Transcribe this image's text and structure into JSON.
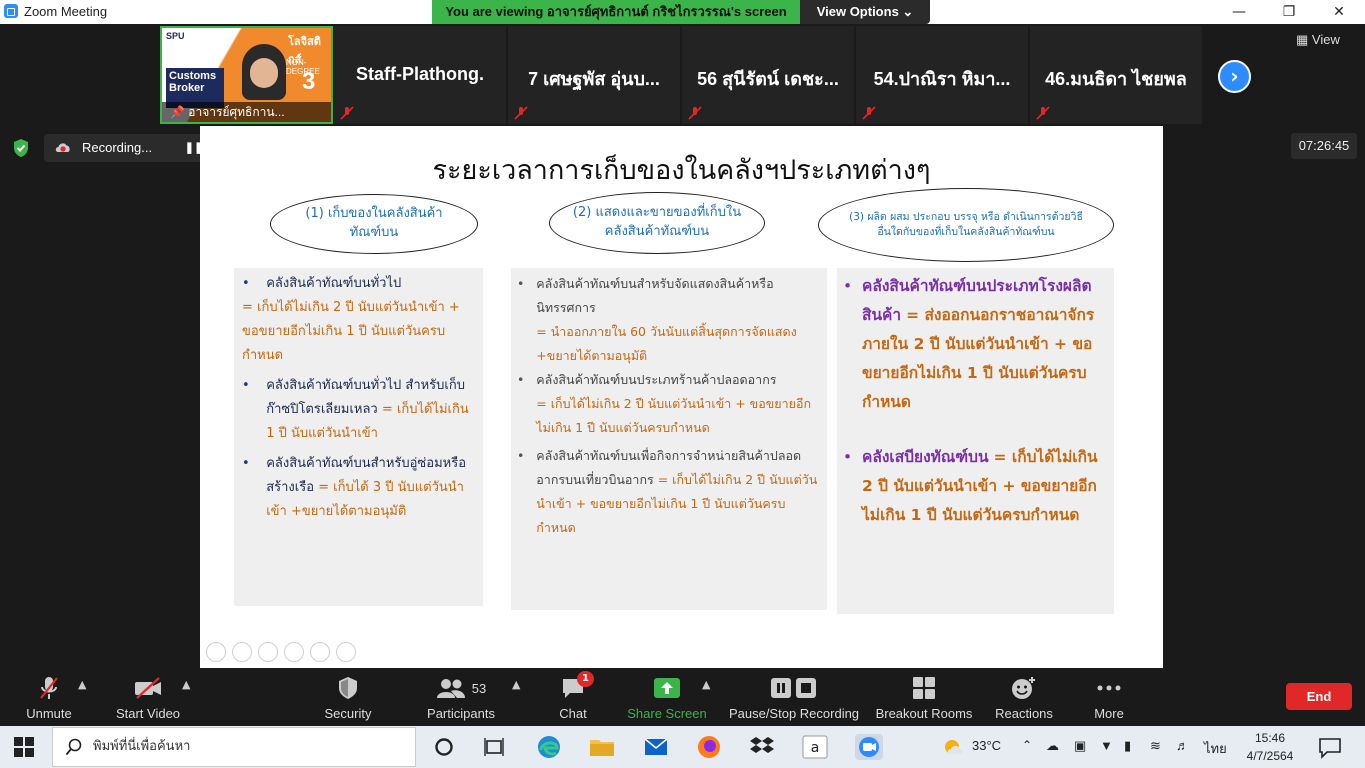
{
  "window": {
    "title": "Zoom Meeting"
  },
  "banner": {
    "viewing": "You are viewing อาจารย์ศุทธิกานต์ กริชไกรวรรณ's screen",
    "view_options": "View Options ⌄"
  },
  "participants_strip": {
    "active": {
      "name": "อาจารย์ศุทธิกาน...",
      "poster_text": "Customs Broker",
      "poster_brand": "SPU",
      "poster_headline": "โลจิสติกส์",
      "poster_sub": "NON-DEGREE",
      "poster_number": "3"
    },
    "tiles": [
      "Staff-Plathong.",
      "7 เศษฐพัส อุ่นบ...",
      "56 สุนีรัตน์ เดชะ...",
      "54.ปาณิรา หิมา...",
      "46.มนธิดา ไชยพล"
    ],
    "view_label": "View",
    "next_label": "›"
  },
  "recording": {
    "label": "Recording...",
    "pause": "❚❚"
  },
  "timer": "07:26:45",
  "slide": {
    "title": "ระยะเวลาการเก็บของในคลังฯประเภทต่างๆ",
    "headers": [
      "(1) เก็บของในคลังสินค้าทัณฑ์บน",
      "(2) แสดงและขายของที่เก็บในคลังสินค้าทัณฑ์บน",
      "(3) ผลิต ผสม ประกอบ บรรจุ หรือ ดำเนินการด้วยวิธีอื่นใดกับของที่เก็บในคลังสินค้าทัณฑ์บน"
    ],
    "col1": [
      {
        "dark": "คลังสินค้าทัณฑ์บนทั่วไป",
        "orange": "= เก็บได้ไม่เกิน 2 ปี นับแต่วันนำเข้า + ขอขยายอีกไม่เกิน 1 ปี นับแต่วันครบกำหนด"
      },
      {
        "dark": "คลังสินค้าทัณฑ์บนทั่วไป สำหรับเก็บก๊าซปิโตรเลียมเหลว",
        "orange": "= เก็บได้ไม่เกิน 1 ปี นับแต่วันนำเข้า"
      },
      {
        "dark": "คลังสินค้าทัณฑ์บนสำหรับอู่ซ่อมหรือสร้างเรือ",
        "orange": "= เก็บได้ 3 ปี นับแต่วันนำเข้า +ขยายได้ตามอนุมัติ"
      }
    ],
    "col2": [
      {
        "dark": "คลังสินค้าทัณฑ์บนสำหรับจัดแสดงสินค้าหรือนิทรรศการ",
        "orange": "= นำออกภายใน 60 วันนับแต่สิ้นสุดการจัดแสดง +ขยายได้ตามอนุมัติ"
      },
      {
        "dark": "คลังสินค้าทัณฑ์บนประเภทร้านค้าปลอดอากร",
        "orange": "= เก็บได้ไม่เกิน 2 ปี นับแต่วันนำเข้า + ขอขยายอีกไม่เกิน 1 ปี นับแต่วันครบกำหนด"
      },
      {
        "dark": "คลังสินค้าทัณฑ์บนเพื่อกิจการจำหน่ายสินค้าปลอดอากรบนเที่ยวบินอากร",
        "orange": "= เก็บได้ไม่เกิน 2 ปี นับแต่วันนำเข้า + ขอขยายอีกไม่เกิน 1 ปี นับแต่วันครบกำหนด"
      }
    ],
    "col3": [
      {
        "purple": "คลังสินค้าทัณฑ์บนประเภทโรงผลิตสินค้า",
        "orange": "= ส่งออกนอกราชอาณาจักรภายใน 2 ปี นับแต่วันนำเข้า + ขอขยายอีกไม่เกิน 1 ปี นับแต่วันครบกำหนด"
      },
      {
        "purple": "คลังเสบียงทัณฑ์บน",
        "orange": "= เก็บได้ไม่เกิน 2 ปี นับแต่วันนำเข้า + ขอขยายอีกไม่เกิน 1 ปี นับแต่วันครบกำหนด"
      }
    ]
  },
  "toolbar": {
    "unmute": "Unmute",
    "start_video": "Start Video",
    "security": "Security",
    "participants": "Participants",
    "participants_count": "53",
    "chat": "Chat",
    "chat_badge": "1",
    "share_screen": "Share Screen",
    "pause_stop_recording": "Pause/Stop Recording",
    "breakout_rooms": "Breakout Rooms",
    "reactions": "Reactions",
    "more": "More",
    "end": "End",
    "share_color": "#3bb54a",
    "end_color": "#e02828"
  },
  "taskbar": {
    "search_placeholder": "พิมพ์ที่นี่เพื่อค้นหา",
    "temperature": "33°C",
    "language": "ไทย",
    "time": "15:46",
    "date": "4/7/2564"
  }
}
